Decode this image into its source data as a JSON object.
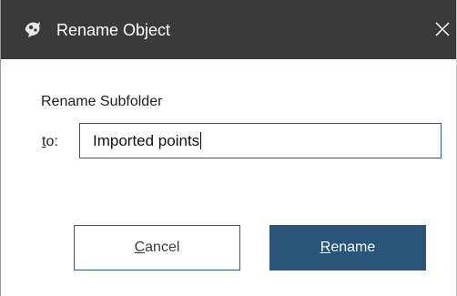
{
  "window": {
    "title": "Rename Object",
    "app_icon": "app-logo-icon",
    "close_icon": "close-icon"
  },
  "form": {
    "heading": "Rename Subfolder",
    "to_label_mnemonic": "t",
    "to_label_rest": "o:",
    "input_value": "Imported points"
  },
  "buttons": {
    "cancel_mnemonic": "C",
    "cancel_rest": "ancel",
    "rename_mnemonic": "R",
    "rename_rest": "ename"
  },
  "colors": {
    "titlebar": "#3a3a3a",
    "accent": "#2a5478",
    "border": "#2f5b82"
  }
}
